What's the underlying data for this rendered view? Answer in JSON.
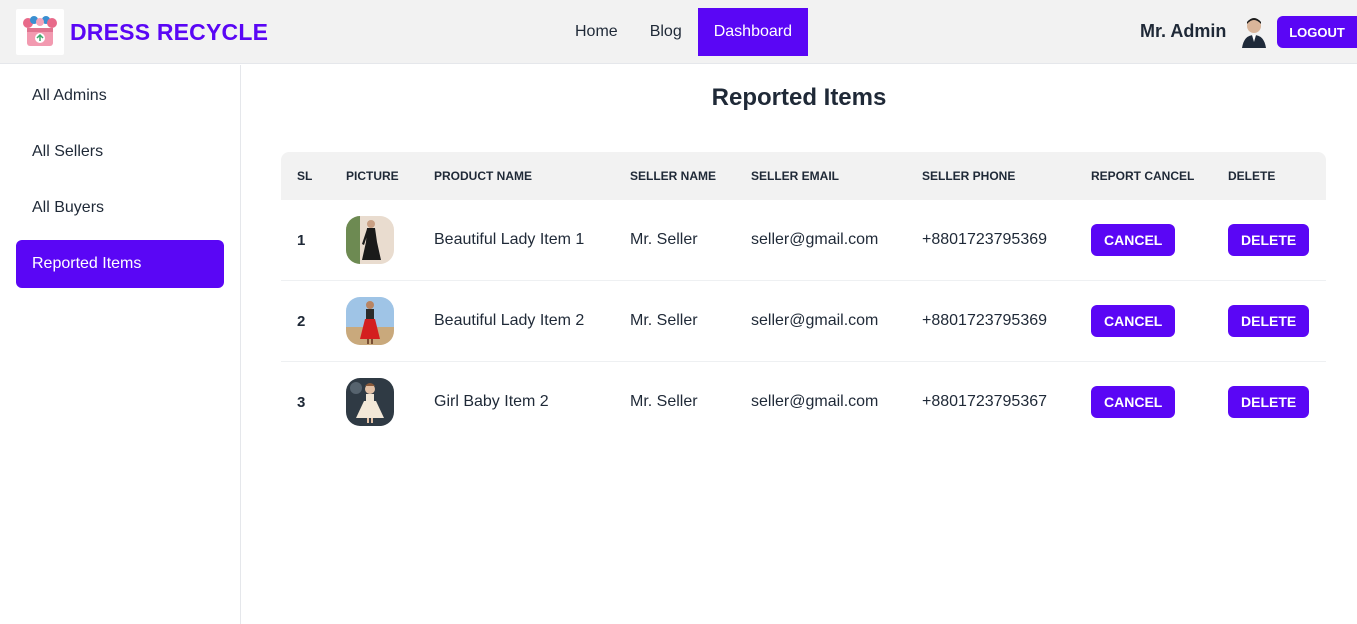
{
  "brand": {
    "name": "DRESS RECYCLE",
    "logo_icon": "recycle-gift-box-logo",
    "accent": "#5a06f5"
  },
  "nav": {
    "links": [
      {
        "label": "Home",
        "active": false
      },
      {
        "label": "Blog",
        "active": false
      },
      {
        "label": "Dashboard",
        "active": true
      }
    ]
  },
  "user": {
    "name": "Mr. Admin",
    "avatar_icon": "user-avatar",
    "logout_label": "LOGOUT"
  },
  "sidebar": {
    "items": [
      {
        "label": "All Admins",
        "active": false
      },
      {
        "label": "All Sellers",
        "active": false
      },
      {
        "label": "All Buyers",
        "active": false
      },
      {
        "label": "Reported Items",
        "active": true
      }
    ]
  },
  "page": {
    "title": "Reported Items"
  },
  "table": {
    "headers": [
      "SL",
      "PICTURE",
      "PRODUCT NAME",
      "SELLER NAME",
      "SELLER EMAIL",
      "SELLER PHONE",
      "REPORT CANCEL",
      "DELETE"
    ],
    "rows": [
      {
        "sl": "1",
        "picture": "lady-black-dress-photo",
        "product_name": "Beautiful Lady Item 1",
        "seller_name": "Mr. Seller",
        "seller_email": "seller@gmail.com",
        "seller_phone": "+8801723795369",
        "cancel_label": "CANCEL",
        "delete_label": "DELETE"
      },
      {
        "sl": "2",
        "picture": "lady-red-dress-photo",
        "product_name": "Beautiful Lady Item 2",
        "seller_name": "Mr. Seller",
        "seller_email": "seller@gmail.com",
        "seller_phone": "+8801723795369",
        "cancel_label": "CANCEL",
        "delete_label": "DELETE"
      },
      {
        "sl": "3",
        "picture": "girl-baby-dress-photo",
        "product_name": "Girl Baby Item 2",
        "seller_name": "Mr. Seller",
        "seller_email": "seller@gmail.com",
        "seller_phone": "+8801723795367",
        "cancel_label": "CANCEL",
        "delete_label": "DELETE"
      }
    ]
  }
}
